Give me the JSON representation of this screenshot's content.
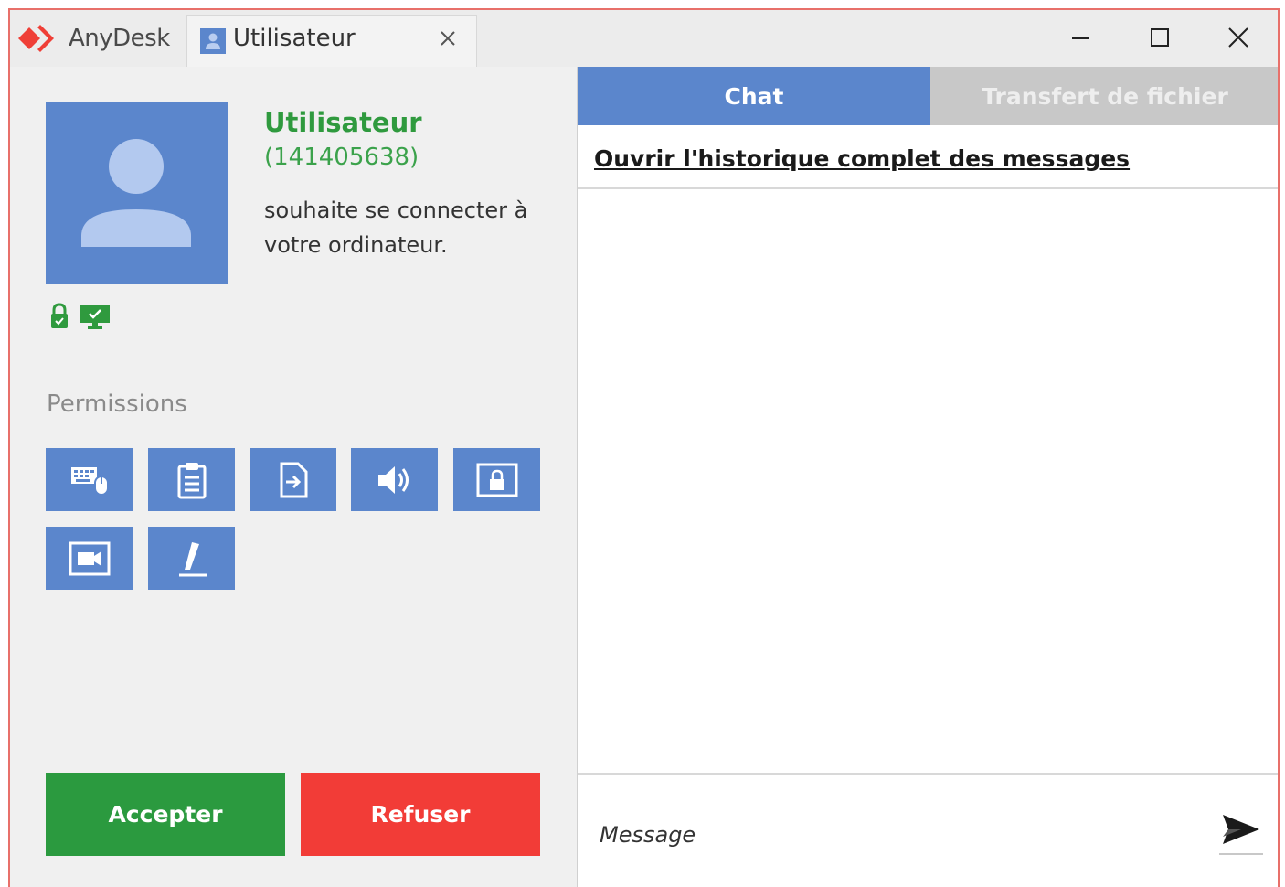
{
  "app": {
    "name": "AnyDesk",
    "brand_color": "#ef3f37"
  },
  "tab": {
    "label": "Utilisateur",
    "icon": "user-icon",
    "close_icon": "close-icon"
  },
  "window_controls": {
    "minimize_icon": "minimize-icon",
    "maximize_icon": "maximize-icon",
    "close_icon": "close-icon"
  },
  "request": {
    "user_name": "Utilisateur",
    "user_id": "(141405638)",
    "message": "souhaite se connecter à votre ordinateur.",
    "status_icons": [
      "lock-icon",
      "monitor-check-icon"
    ]
  },
  "permissions": {
    "title": "Permissions",
    "items": [
      {
        "icon": "keyboard-mouse-icon"
      },
      {
        "icon": "clipboard-icon"
      },
      {
        "icon": "file-transfer-icon"
      },
      {
        "icon": "sound-icon"
      },
      {
        "icon": "lock-screen-icon"
      },
      {
        "icon": "record-session-icon"
      },
      {
        "icon": "whiteboard-pen-icon"
      }
    ]
  },
  "actions": {
    "accept": "Accepter",
    "refuse": "Refuser",
    "accept_color": "#2b9a3f",
    "refuse_color": "#f23c37"
  },
  "chat_panel": {
    "tabs": [
      {
        "label": "Chat",
        "active": true
      },
      {
        "label": "Transfert de fichier",
        "active": false
      }
    ],
    "history_link": "Ouvrir l'historique complet des messages",
    "input_placeholder": "Message",
    "send_icon": "send-icon"
  },
  "colors": {
    "accent": "#5b86cc",
    "green": "#2f9a3e"
  }
}
